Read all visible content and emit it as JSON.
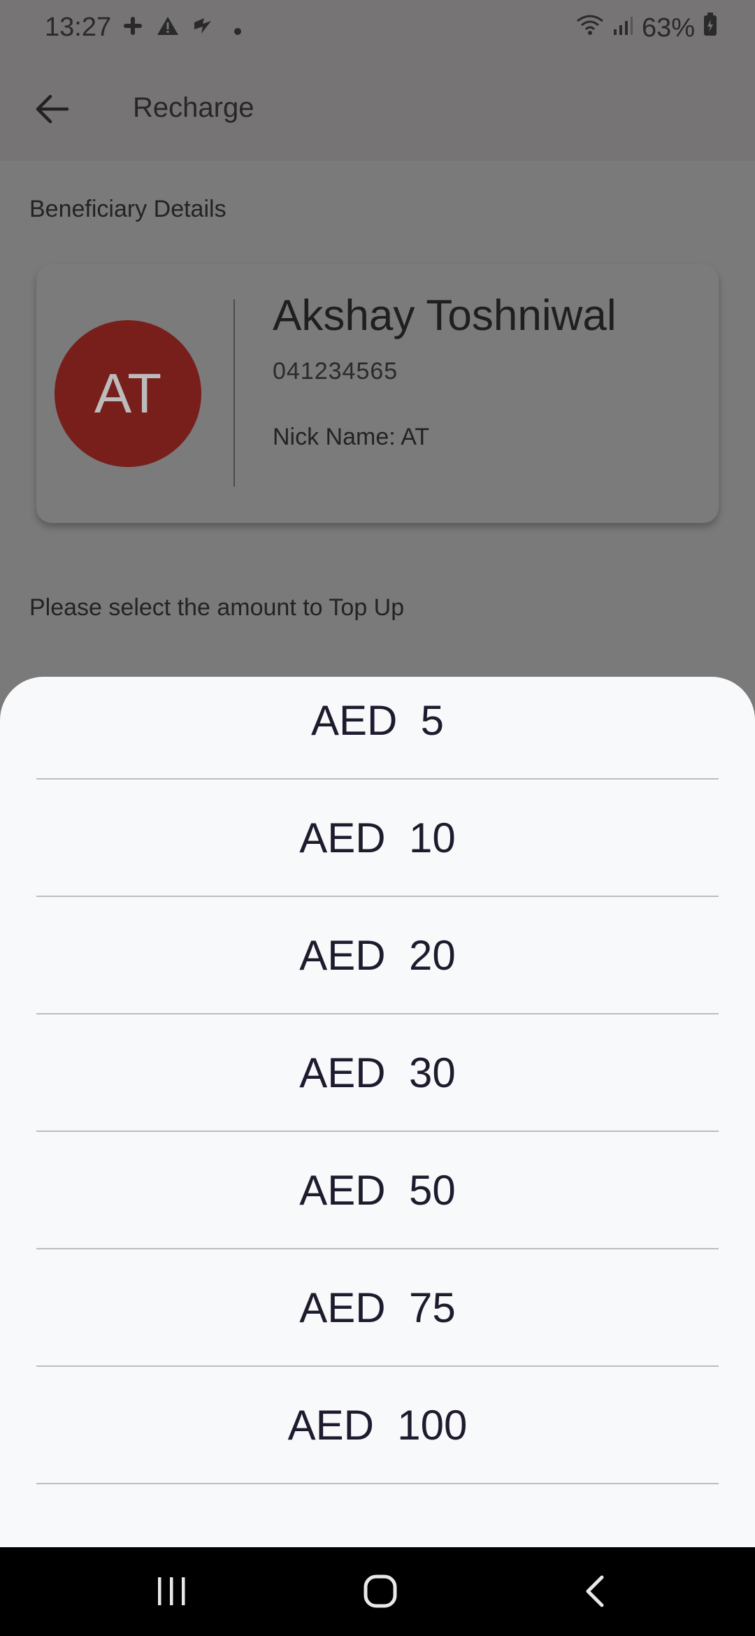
{
  "status_bar": {
    "time": "13:27",
    "battery": "63%",
    "left_icons": [
      "slack-icon",
      "warning-icon",
      "app-notification-icon",
      "dot-icon"
    ],
    "right_icons": [
      "wifi-icon",
      "signal-icon",
      "battery-icon"
    ]
  },
  "app_bar": {
    "title": "Recharge",
    "back_icon": "arrow-left-icon"
  },
  "content": {
    "beneficiary_label": "Beneficiary Details",
    "beneficiary": {
      "initials": "AT",
      "name": "Akshay Toshniwal",
      "phone": "041234565",
      "nick_name": "Nick Name: AT"
    },
    "select_label": "Please select the amount to Top Up"
  },
  "sheet": {
    "amounts": [
      "AED  5",
      "AED  10",
      "AED  20",
      "AED  30",
      "AED  50",
      "AED  75",
      "AED  100"
    ]
  },
  "colors": {
    "avatar": "#781f1c",
    "sheet_background": "#f8f9fa",
    "scrim": "#767474"
  }
}
